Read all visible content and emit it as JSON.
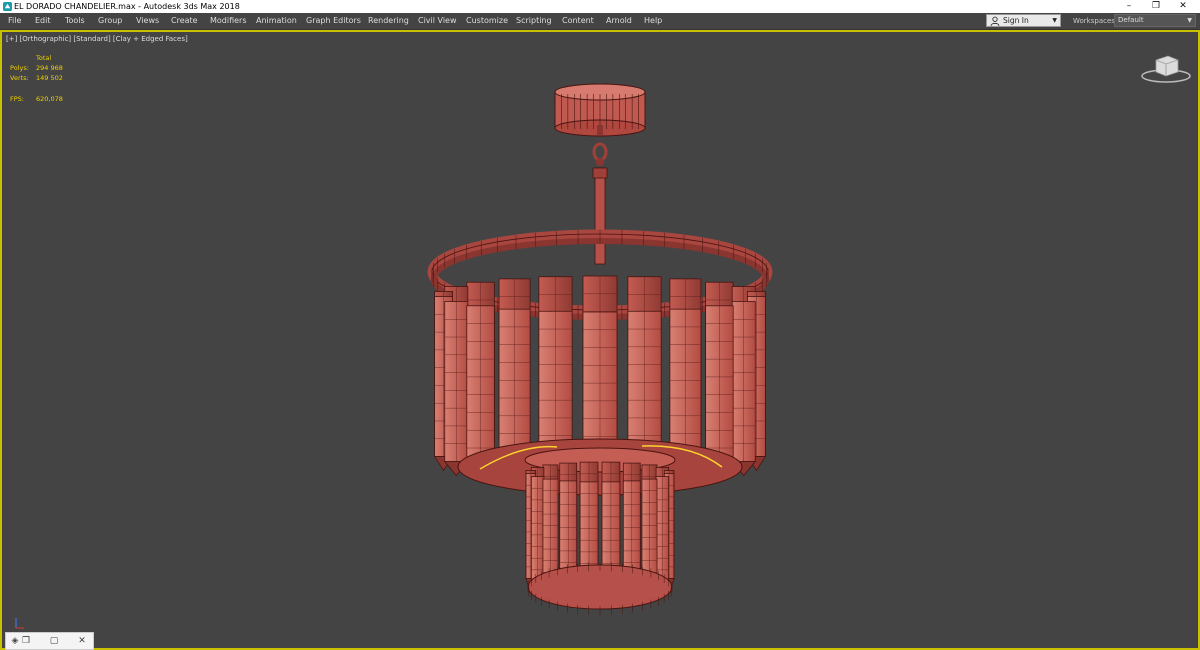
{
  "window": {
    "title": "EL DORADO CHANDELIER.max - Autodesk 3ds Max 2018",
    "minimize": "–",
    "restore": "❐",
    "close": "✕"
  },
  "menu": {
    "items": [
      "File",
      "Edit",
      "Tools",
      "Group",
      "Views",
      "Create",
      "Modifiers",
      "Animation",
      "Graph Editors",
      "Rendering",
      "Civil View",
      "Customize",
      "Scripting",
      "Content",
      "Arnold",
      "Help"
    ],
    "sign_in": "Sign In",
    "workspaces_label": "Workspaces:",
    "workspace_value": "Default"
  },
  "viewport": {
    "label": "[+] [Orthographic] [Standard] [Clay + Edged Faces]",
    "stats": {
      "header": "Total",
      "polys_label": "Polys:",
      "polys_value": "294 968",
      "verts_label": "Verts:",
      "verts_value": "149 502",
      "fps_label": "FPS:",
      "fps_value": "620,078"
    }
  },
  "colors": {
    "viewport_bg": "#444444",
    "active_border": "#c8c000",
    "stats_text": "#f2d000",
    "mesh_fill": "#c0584e",
    "mesh_light": "#d77a6f",
    "mesh_dark": "#8a3530",
    "wire": "#4a1410",
    "selection": "#ffd22e"
  },
  "icons": {
    "app": "3ds-max-icon",
    "user": "user-icon",
    "viewcube": "viewcube-icon",
    "axis": "axis-tripod-icon"
  }
}
